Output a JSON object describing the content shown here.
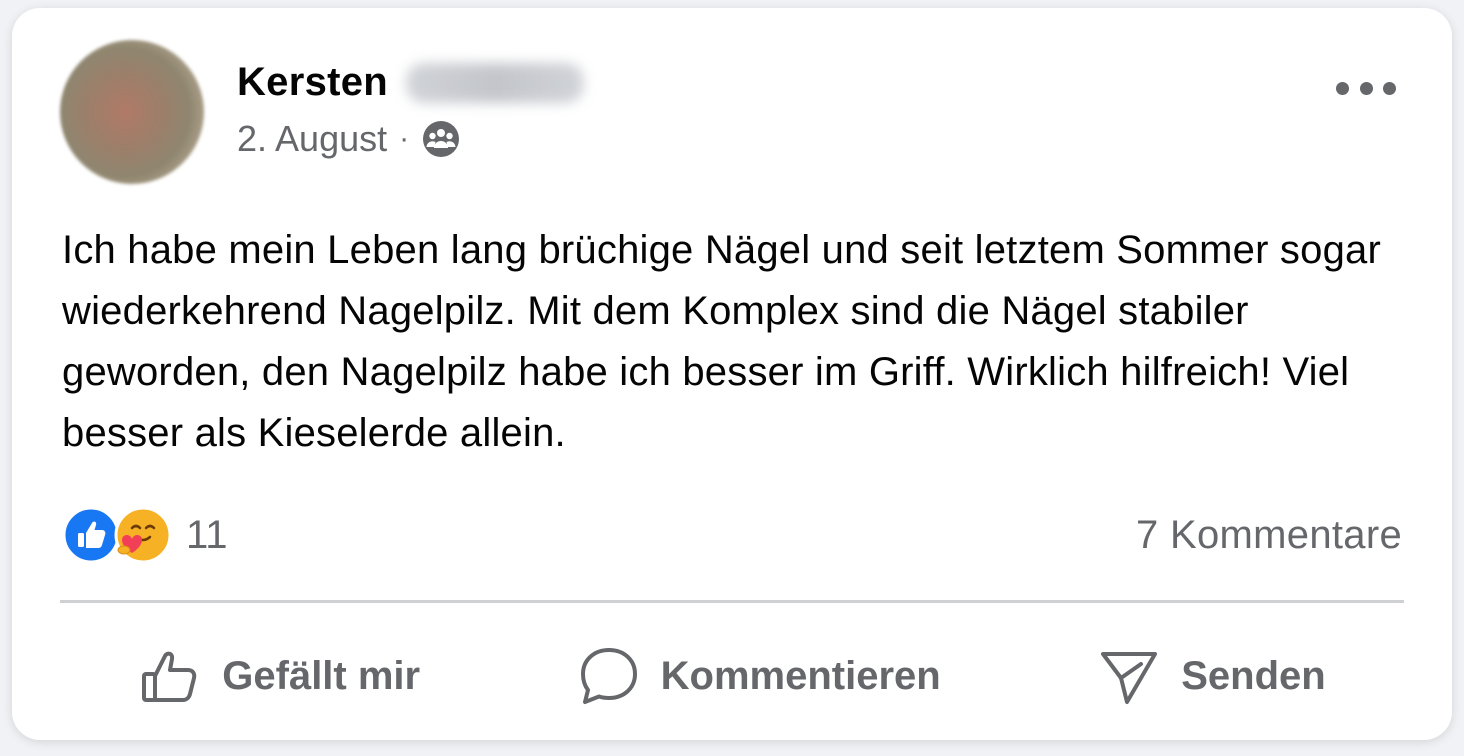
{
  "post": {
    "author_first_name": "Kersten",
    "date": "2. August",
    "separator": "·",
    "audience_icon": "group-icon",
    "text": "Ich habe mein Leben lang brüchige Nägel und seit letztem Sommer sogar wiederkehrend Nagelpilz. Mit dem Komplex sind die Nägel stabiler geworden, den Nagelpilz habe ich besser im Griff. Wirklich hilfreich! Viel besser als Kieselerde allein."
  },
  "reactions": {
    "types": [
      "like-icon",
      "care-icon"
    ],
    "count": "11",
    "comments": "7 Kommentare"
  },
  "actions": {
    "like_label": "Gefällt mir",
    "comment_label": "Kommentieren",
    "send_label": "Senden"
  },
  "colors": {
    "text_primary": "#050505",
    "text_secondary": "#65676b",
    "like_blue": "#1877f2",
    "divider": "#ced0d4"
  }
}
